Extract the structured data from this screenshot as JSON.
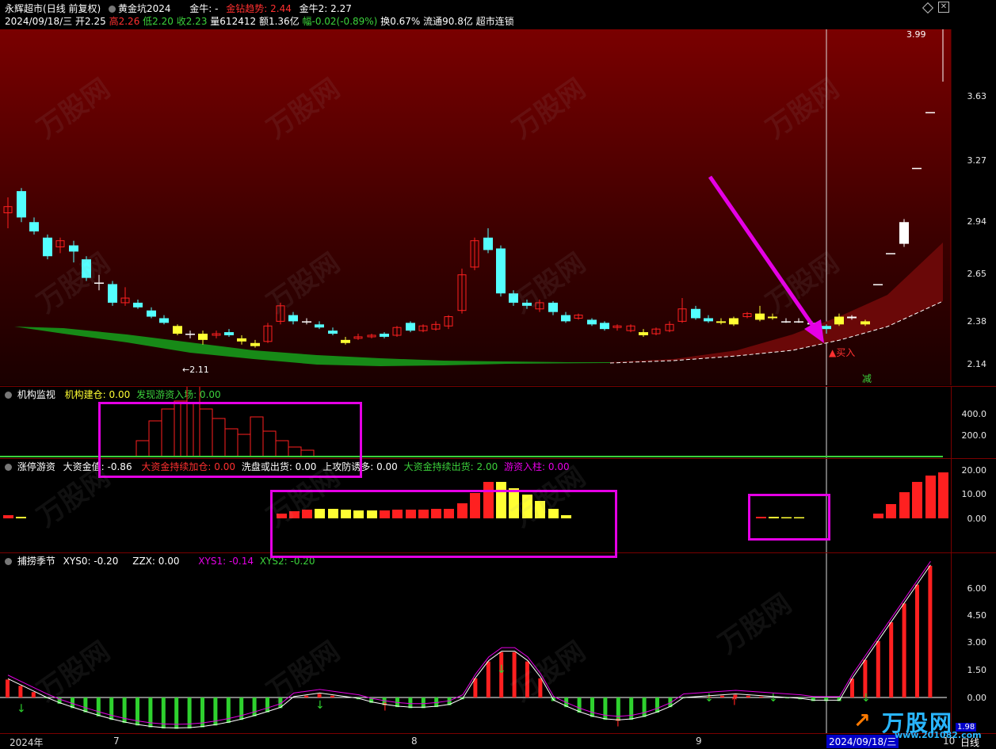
{
  "header": {
    "stock_name": "永辉超市",
    "mode": "(日线 前复权)",
    "indicator_name": "黄金坑2024",
    "jinniu_label": "金牛: -",
    "jinzuan_label": "金钻趋势: 2.44",
    "jinniu2_label": "金牛2: 2.27",
    "date": "2024/09/18/三",
    "open": "开2.25",
    "high": "高2.26",
    "low": "低2.20",
    "close": "收2.23",
    "volume": "量612412",
    "amount": "额1.36亿",
    "change": "幅-0.02(-0.89%)",
    "turnover": "换0.67%",
    "float": "流通90.8亿",
    "sector": "超市连锁"
  },
  "main_axis": [
    "3.99",
    "3.63",
    "3.27",
    "2.94",
    "2.65",
    "2.38",
    "2.14"
  ],
  "main_annotations": {
    "low_price": "←2.11",
    "buy": "▲买入",
    "reduce": "减"
  },
  "panel1": {
    "title": "机构监视",
    "f1": "机构建仓: 0.00",
    "f2": "发现游资入场: 0.00",
    "axis": [
      "400.0",
      "200.0"
    ]
  },
  "panel2": {
    "title": "涨停游资",
    "f1": "大资金值: -0.86",
    "f2": "大资金持续加仓: 0.00",
    "f3": "洗盘或出货: 0.00",
    "f4": "上攻防诱多: 0.00",
    "f5": "大资金持续出货: 2.00",
    "f6": "游资入柱: 0.00",
    "axis": [
      "20.00",
      "10.00",
      "0.00"
    ]
  },
  "panel3": {
    "title": "捕捞季节",
    "f1": "XYS0: -0.20",
    "f2": "ZZX: 0.00",
    "f3": "XYS1: -0.14",
    "f4": "XYS2: -0.20",
    "axis": [
      "6.00",
      "4.50",
      "3.00",
      "1.50",
      "0.00"
    ]
  },
  "bottom_axis": {
    "y2024": "2024年",
    "m7": "7",
    "m8": "8",
    "m9": "9",
    "cursor_date": "2024/09/18/三",
    "m10": "10",
    "period": "日线",
    "corner": "1.98"
  },
  "logo": {
    "brand": "万股网",
    "url": "www.201082.com"
  },
  "watermark": {
    "text": "万股网",
    "url": "www.201082.com"
  },
  "colors": {
    "bg": "#000000",
    "up_red": "#ff2020",
    "down_cyan": "#54ffff",
    "yellow": "#ffff33",
    "green": "#2ed12e",
    "magenta": "#e500e5",
    "frame": "#7a0000"
  }
}
